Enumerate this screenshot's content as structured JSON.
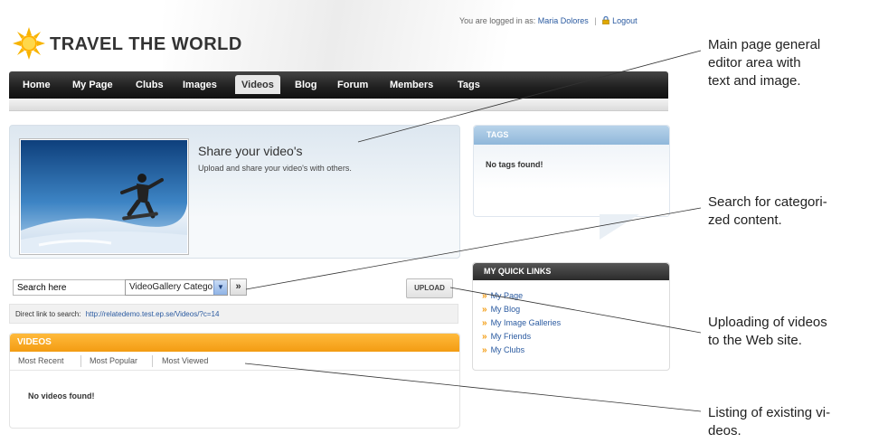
{
  "header": {
    "site_name": "TRAVEL THE WORLD",
    "logged_in_label": "You are logged in as:",
    "user_name": "Maria Dolores",
    "separator": "|",
    "logout_label": "Logout"
  },
  "nav": {
    "items": [
      {
        "label": "Home"
      },
      {
        "label": "My Page"
      },
      {
        "label": "Clubs"
      },
      {
        "label": "Images"
      },
      {
        "label": "Videos",
        "active": true
      },
      {
        "label": "Blog"
      },
      {
        "label": "Forum"
      },
      {
        "label": "Members"
      },
      {
        "label": "Tags"
      }
    ]
  },
  "hero": {
    "title": "Share your video's",
    "description": "Upload and share your video's with others."
  },
  "search": {
    "input_value": "Search here",
    "category_selected": "VideoGallery Catego",
    "go_label": "»",
    "upload_label": "UPLOAD",
    "direct_link_label": "Direct link to search:",
    "direct_link_url": "http://relatedemo.test.ep.se/Videos/?c=14"
  },
  "videos": {
    "title": "VIDEOS",
    "tabs": [
      "Most Recent",
      "Most Popular",
      "Most Viewed"
    ],
    "empty_text": "No videos found!"
  },
  "tags": {
    "title": "TAGS",
    "empty_text": "No tags found!"
  },
  "quick_links": {
    "title": "MY QUICK LINKS",
    "bullet": "»",
    "items": [
      "My Page",
      "My Blog",
      "My Image Galleries",
      "My Friends",
      "My Clubs"
    ]
  },
  "annotations": [
    {
      "lines": [
        "Main page general",
        "editor area with",
        "text and image."
      ]
    },
    {
      "lines": [
        "Search for categori-",
        "zed content."
      ]
    },
    {
      "lines": [
        "Uploading of videos",
        "to the Web site."
      ]
    },
    {
      "lines": [
        "Listing of existing vi-",
        "deos."
      ]
    }
  ],
  "colors": {
    "accent_orange": "#f39c12",
    "nav_dark": "#1f1f1f",
    "link_blue": "#2a5aa0",
    "tags_header_blue": "#8fb7da"
  }
}
